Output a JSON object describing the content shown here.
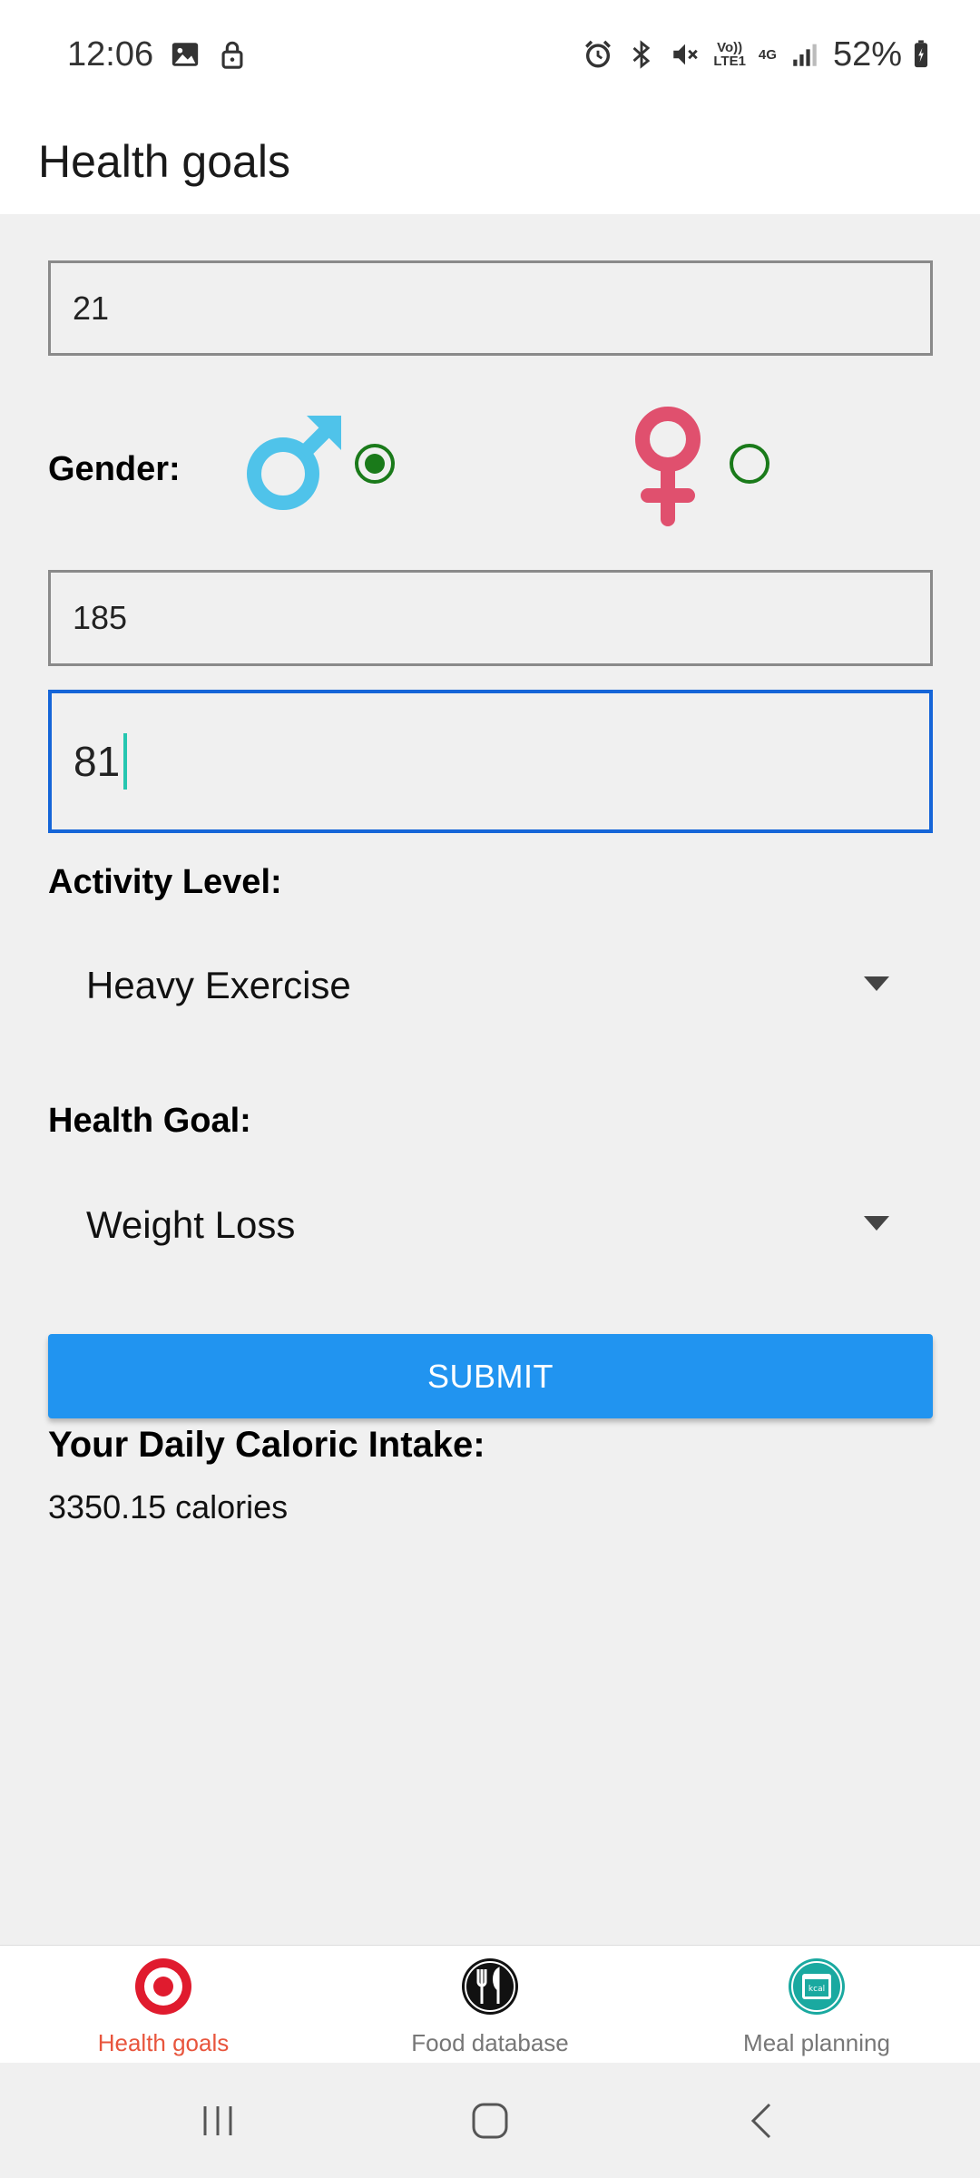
{
  "status_bar": {
    "time": "12:06",
    "battery": "52%",
    "network_label_top": "Vo))",
    "network_label_bottom": "LTE1",
    "network_type": "4G"
  },
  "app_bar": {
    "title": "Health goals"
  },
  "form": {
    "age_value": "21",
    "gender_label": "Gender:",
    "gender_selected": "male",
    "height_value": "185",
    "weight_value": "81",
    "activity_label": "Activity Level:",
    "activity_selected": "Heavy Exercise",
    "goal_label": "Health Goal:",
    "goal_selected": "Weight Loss",
    "submit_label": "SUBMIT"
  },
  "result": {
    "title": "Your Daily Caloric Intake:",
    "value": "3350.15 calories"
  },
  "bottom_nav": {
    "items": [
      {
        "label": "Health goals",
        "icon": "target-icon",
        "active": true
      },
      {
        "label": "Food database",
        "icon": "fork-knife-icon",
        "active": false
      },
      {
        "label": "Meal planning",
        "icon": "kcal-calendar-icon",
        "active": false
      }
    ]
  },
  "colors": {
    "male": "#4fc3ea",
    "female": "#e0506e",
    "radio": "#1a7a1a",
    "submit": "#2194f0",
    "focus_border": "#1565d8",
    "active_nav": "#e8553d"
  }
}
